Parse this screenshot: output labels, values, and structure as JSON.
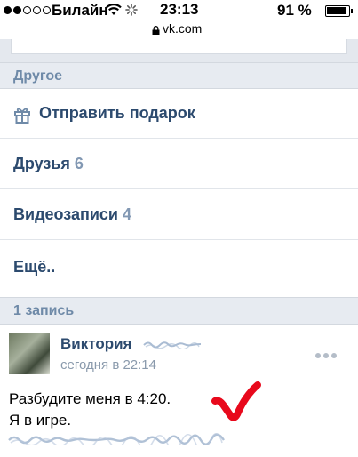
{
  "status_bar": {
    "carrier": "Билайн",
    "time": "23:13",
    "battery_percent": "91 %",
    "signal_dots_filled": 2,
    "signal_dots_total": 5
  },
  "browser": {
    "url": "vk.com"
  },
  "sections": {
    "other_header": "Другое",
    "posts_header": "1 запись"
  },
  "menu": {
    "send_gift": "Отправить подарок",
    "friends_label": "Друзья",
    "friends_count": "6",
    "videos_label": "Видеозаписи",
    "videos_count": "4",
    "more": "Ещё.."
  },
  "post": {
    "author": "Виктория",
    "time": "сегодня в 22:14",
    "text_line1": "Разбудите меня в 4:20.",
    "text_line2": "Я в игре."
  },
  "colors": {
    "link_blue": "#2c4a6e",
    "header_text": "#6f8aa8",
    "count_gray": "#8298b3",
    "checkmark_red": "#e8091c",
    "header_bg": "#e7ebf1"
  }
}
